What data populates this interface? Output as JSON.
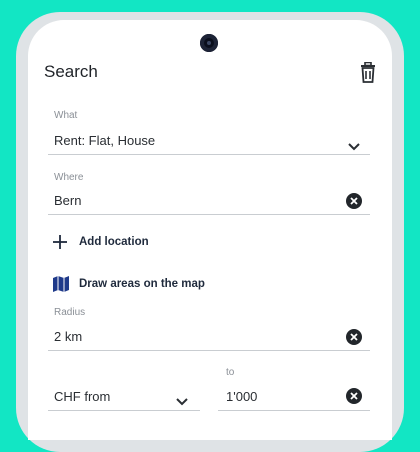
{
  "header": {
    "title": "Search"
  },
  "what": {
    "label": "What",
    "value": "Rent: Flat, House"
  },
  "where": {
    "label": "Where",
    "value": "Bern"
  },
  "add_location": {
    "label": "Add location"
  },
  "draw_areas": {
    "label": "Draw areas on the map"
  },
  "radius": {
    "label": "Radius",
    "value": "2 km"
  },
  "price": {
    "from_value": "CHF from",
    "to_label": "to",
    "to_value": "1'000"
  },
  "colors": {
    "background": "#12e6c4",
    "icon": "#1f3a8a",
    "text": "#1f2328"
  },
  "icons": [
    "trash-icon",
    "chevron-down-icon",
    "clear-icon",
    "plus-icon",
    "map-icon"
  ]
}
